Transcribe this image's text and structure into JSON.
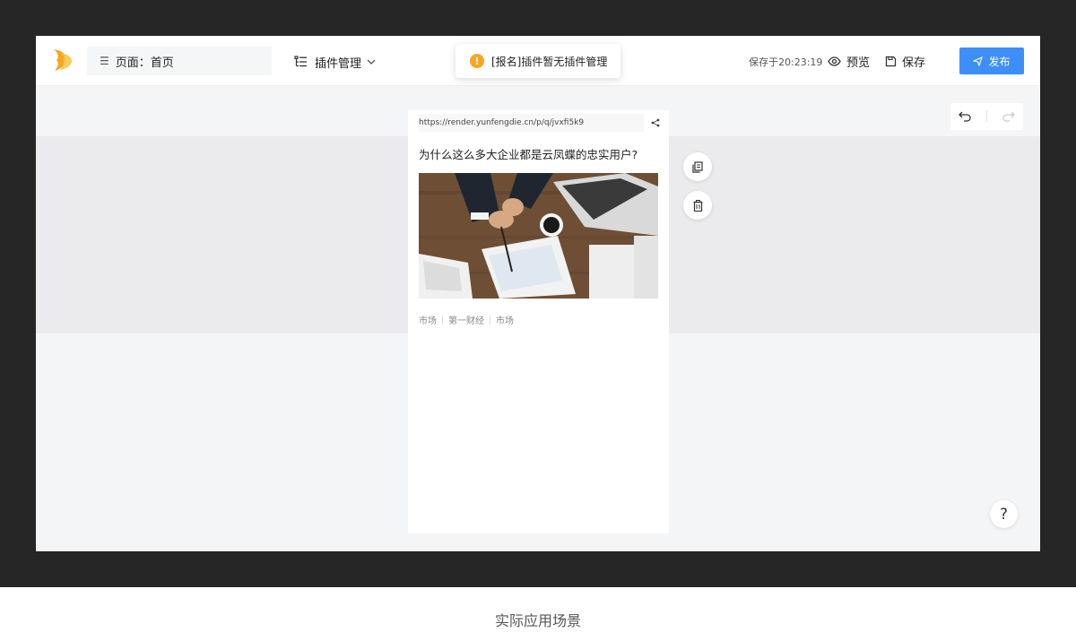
{
  "header": {
    "page_selector_label": "页面：首页",
    "plugin_menu_label": "插件管理",
    "save_time": "保存于20:23:19",
    "preview_label": "预览",
    "save_label": "保存",
    "publish_label": "发布",
    "brand_color": "#3e8ef7"
  },
  "toast": {
    "message": "[报名]插件暂无插件管理",
    "icon": "warning-icon"
  },
  "preview": {
    "url": "https://render.yunfengdie.cn/p/q/jvxfi5k9",
    "article_title": "为什么这么多大企业都是云凤蝶的忠实用户?",
    "tags": [
      "市场",
      "第一财经",
      "市场"
    ]
  },
  "help_label": "?",
  "caption": "实际应用场景"
}
